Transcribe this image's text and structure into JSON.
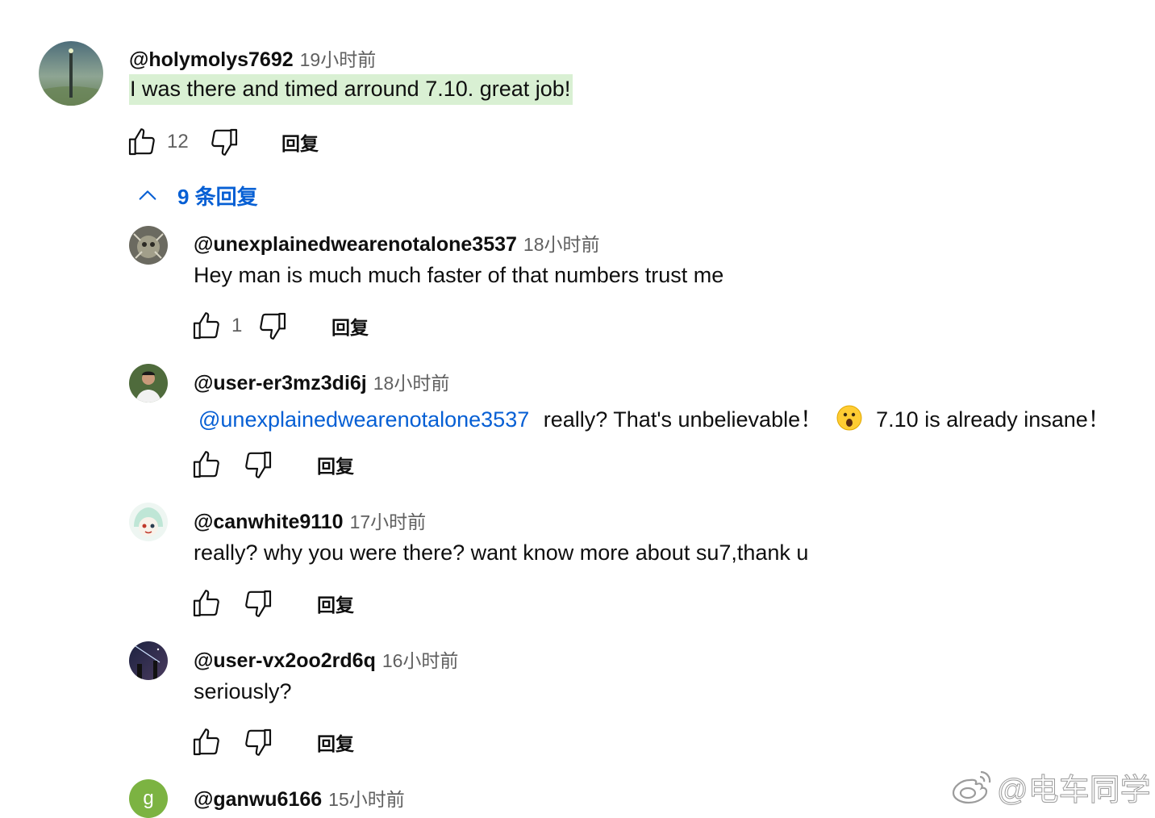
{
  "top_comment": {
    "author": "@holymolys7692",
    "time": "19小时前",
    "text": "I was there and timed arround 7.10. great job!",
    "likes": "12",
    "reply_label": "回复",
    "icon_like": "thumb-up-icon",
    "icon_dislike": "thumb-down-icon"
  },
  "replies_toggle": {
    "label": "9 条回复",
    "icon": "chevron-up-icon"
  },
  "replies": [
    {
      "author": "@unexplainedwearenotalone3537",
      "time": "18小时前",
      "text": "Hey man is much much faster of that numbers trust me",
      "likes": "1",
      "reply_label": "回复"
    },
    {
      "author": "@user-er3mz3di6j",
      "time": "18小时前",
      "mention": "@unexplainedwearenotalone3537",
      "text_before_emoji": "really? That's unbelievable！",
      "emoji": "astonished-face-emoji",
      "text_after_emoji": "7.10 is already  insane！",
      "reply_label": "回复"
    },
    {
      "author": "@canwhite9110",
      "time": "17小时前",
      "text": "really? why you were there? want know more about su7,thank u",
      "reply_label": "回复"
    },
    {
      "author": "@user-vx2oo2rd6q",
      "time": "16小时前",
      "text": "seriously?",
      "reply_label": "回复"
    },
    {
      "author": "@ganwu6166",
      "time": "15小时前",
      "avatar_letter": "g"
    }
  ],
  "watermark": {
    "text": "@电车同学",
    "icon": "weibo-logo-icon"
  },
  "colors": {
    "link_blue": "#065fd4",
    "highlight_green": "#d9f0d3",
    "secondary_text": "#606060",
    "avatar_green": "#7cb342"
  }
}
